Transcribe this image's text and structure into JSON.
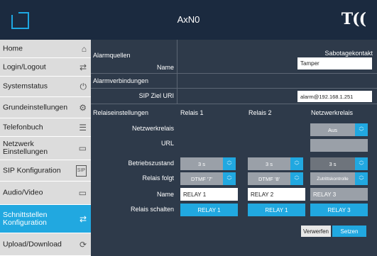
{
  "header": {
    "title": "AxN0",
    "brand": "T(("
  },
  "sidebar": {
    "items": [
      {
        "label": "Home",
        "icon": "⌂"
      },
      {
        "label": "Login/Logout",
        "icon": "⇄"
      },
      {
        "label": "Systemstatus",
        "icon": "⏻"
      },
      {
        "label": "Grundeinstellungen",
        "icon": "⚙"
      },
      {
        "label": "Telefonbuch",
        "icon": "☰"
      },
      {
        "label": "Netzwerk Einstellungen",
        "icon": "▭"
      },
      {
        "label": "SIP Konfiguration",
        "icon": "SIP"
      },
      {
        "label": "Audio/Video",
        "icon": "▭"
      },
      {
        "label": "Schnittstellen Konfiguration",
        "icon": "⇄"
      },
      {
        "label": "Upload/Download",
        "icon": "⟳"
      }
    ]
  },
  "alarm": {
    "section1": "Alarmquellen",
    "name_label": "Name",
    "sabotage_header": "Sabotagekontakt",
    "sabotage_value": "Tamper",
    "section2": "Alarmverbindungen",
    "sip_label": "SIP Ziel URI",
    "sip_value": "alarm@192.168.1.251"
  },
  "relay": {
    "section": "Relaiseinstellungen",
    "col1": "Relais 1",
    "col2": "Relais 2",
    "col3": "Netzwerkrelais",
    "netrelay_label": "Netzwerkrelais",
    "netrelay_value": "Aus",
    "url_label": "URL",
    "state_label": "Betriebszustand",
    "state1": "3 s",
    "state2": "3 s",
    "state3": "3 s",
    "follows_label": "Relais folgt",
    "follows1": "DTMF '7'",
    "follows2": "DTMF '8'",
    "follows3": "Zutrittskontrolle",
    "name_label": "Name",
    "name1": "RELAY 1",
    "name2": "RELAY 2",
    "name3": "RELAY 3",
    "switch_label": "Relais schalten",
    "switch1": "RELAY 1",
    "switch2": "RELAY 1",
    "switch3": "RELAY 3"
  },
  "actions": {
    "discard": "Verwerfen",
    "save": "Setzen"
  }
}
